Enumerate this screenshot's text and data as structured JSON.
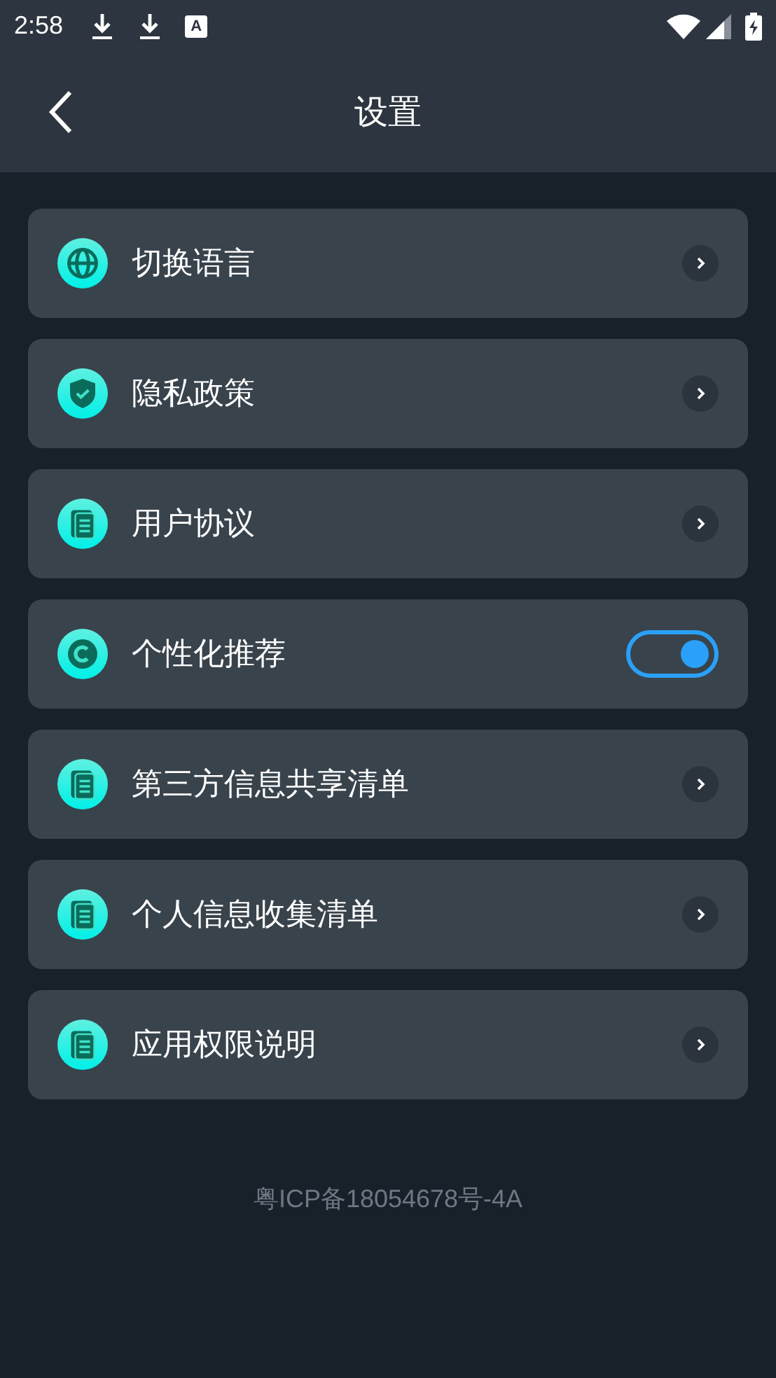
{
  "status_bar": {
    "time": "2:58",
    "app_glyph": "A"
  },
  "header": {
    "title": "设置"
  },
  "items": [
    {
      "kind": "link",
      "label": "切换语言"
    },
    {
      "kind": "link",
      "label": "隐私政策"
    },
    {
      "kind": "link",
      "label": "用户协议"
    },
    {
      "kind": "toggle",
      "label": "个性化推荐",
      "on": true
    },
    {
      "kind": "link",
      "label": "第三方信息共享清单"
    },
    {
      "kind": "link",
      "label": "个人信息收集清单"
    },
    {
      "kind": "link",
      "label": "应用权限说明"
    }
  ],
  "footer": {
    "text": "粤ICP备18054678号-4A"
  }
}
